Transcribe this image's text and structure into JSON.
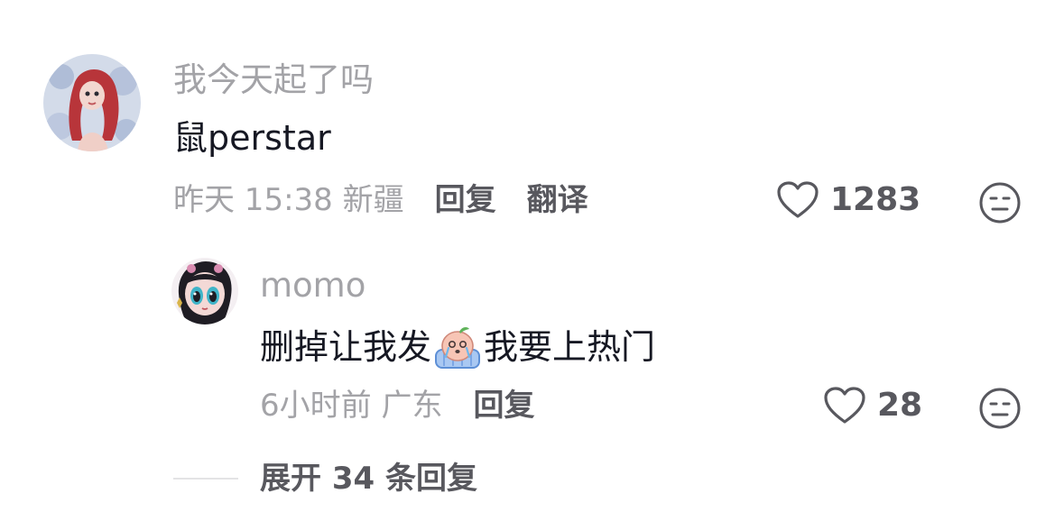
{
  "comments": [
    {
      "username": "我今天起了吗",
      "text": "鼠perstar",
      "time_location": "昨天 15:38 新疆",
      "reply_label": "回复",
      "translate_label": "翻译",
      "like_count": "1283",
      "avatar_icon": "avatar-icon",
      "colors": {
        "avatar_bg": "#c9d3e6",
        "avatar_hair": "#b8353a"
      }
    },
    {
      "username": "momo",
      "text_before": "删掉让我发",
      "text_after": "我要上热门",
      "sticker_icon": "crying-peach-sticker-icon",
      "time_location": "6小时前 广东",
      "reply_label": "回复",
      "like_count": "28",
      "avatar_icon": "avatar-icon"
    }
  ],
  "expand_label": "展开 34 条回复",
  "colors": {
    "text_primary": "#161823",
    "text_secondary": "#a3a3a7",
    "text_action": "#58585e",
    "divider": "#e3e3e5"
  }
}
